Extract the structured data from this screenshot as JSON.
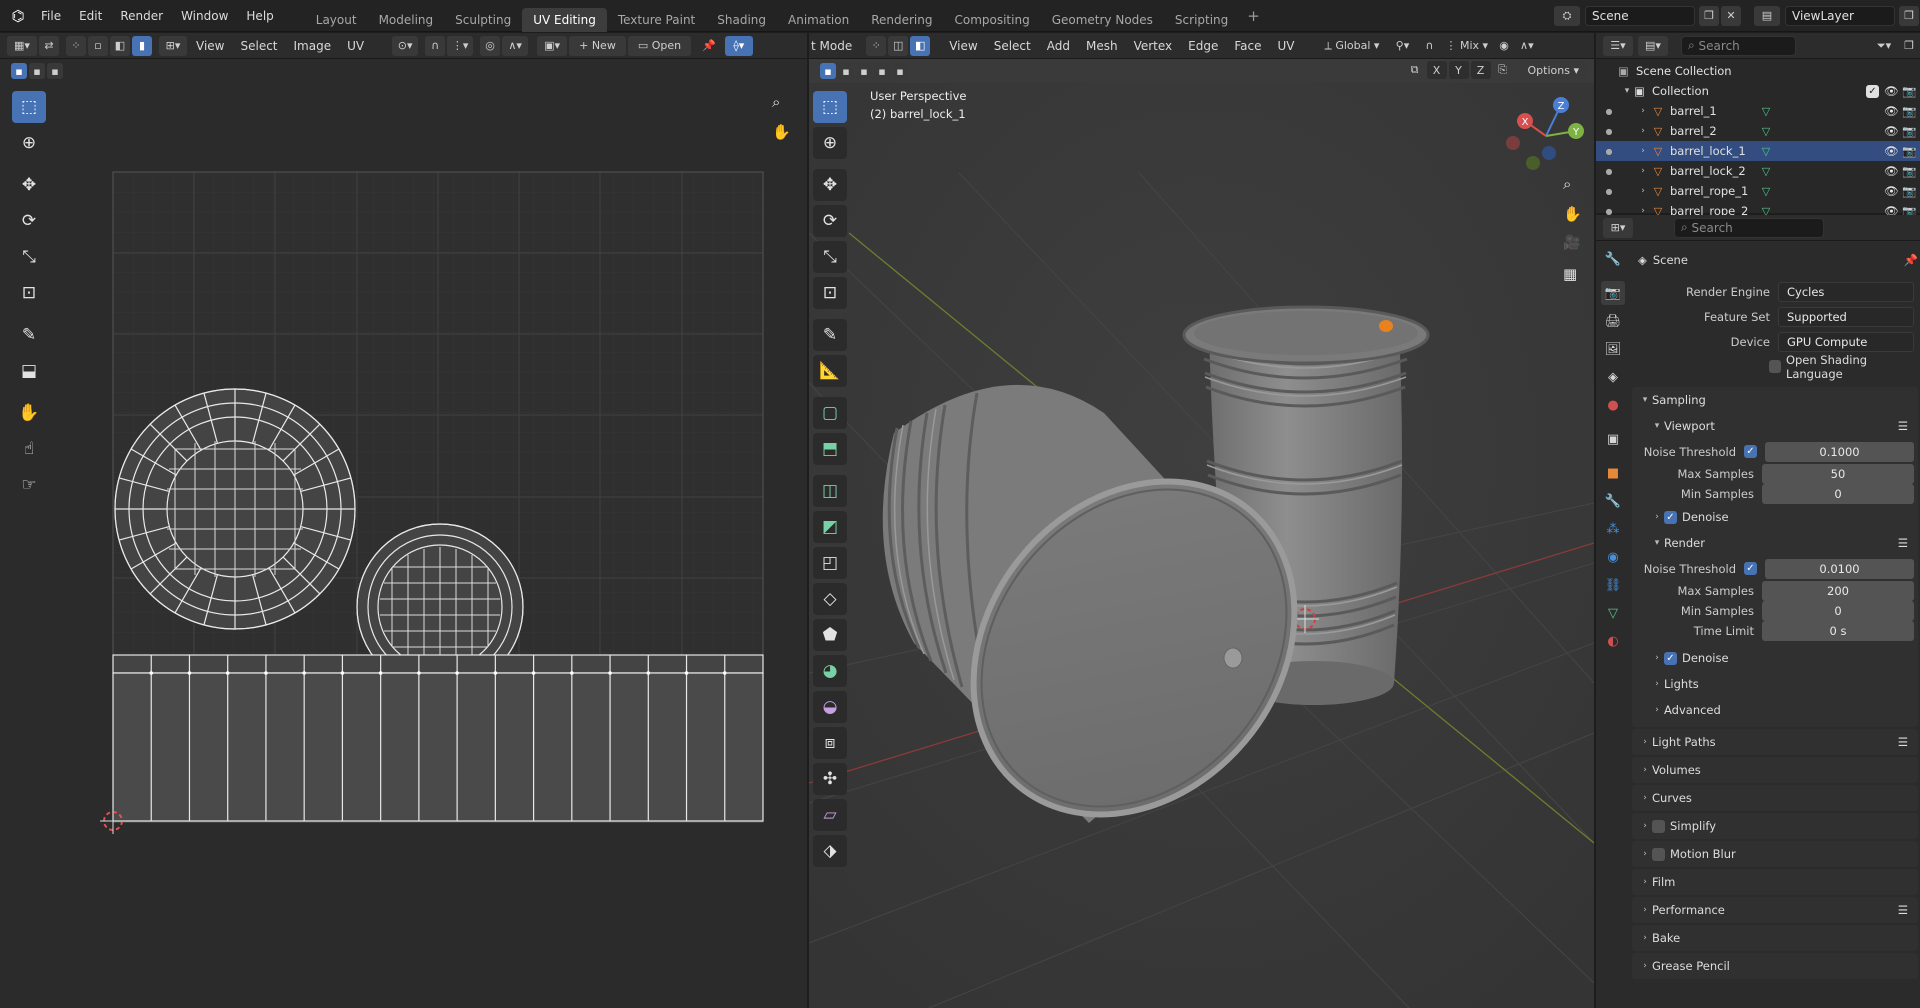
{
  "topbar": {
    "menus": [
      "File",
      "Edit",
      "Render",
      "Window",
      "Help"
    ],
    "workspaces": [
      "Layout",
      "Modeling",
      "Sculpting",
      "UV Editing",
      "Texture Paint",
      "Shading",
      "Animation",
      "Rendering",
      "Compositing",
      "Geometry Nodes",
      "Scripting"
    ],
    "active_workspace": "UV Editing",
    "scene": "Scene",
    "view_layer": "ViewLayer"
  },
  "uv_editor": {
    "header_menus": [
      "View",
      "Select",
      "Image",
      "UV"
    ],
    "new_label": "New",
    "open_label": "Open",
    "tools": [
      "select-box-icon",
      "cursor-icon",
      "move-icon",
      "rotate-icon",
      "scale-icon",
      "transform-icon",
      "annotate-icon",
      "rip-region-icon",
      "grab-icon",
      "relax-icon",
      "pinch-icon"
    ]
  },
  "viewport": {
    "mode_label": "t Mode",
    "header_menus": [
      "View",
      "Select",
      "Add",
      "Mesh",
      "Vertex",
      "Edge",
      "Face",
      "UV"
    ],
    "transform_orientation": "Global",
    "mix_label": "Mix",
    "axes": [
      "X",
      "Y",
      "Z"
    ],
    "options_label": "Options",
    "overlay_line1": "User Perspective",
    "overlay_line2": "(2) barrel_lock_1",
    "gizmo_axes": [
      "X",
      "Y",
      "Z"
    ]
  },
  "outliner": {
    "search_placeholder": "Search",
    "root": "Scene Collection",
    "collection": "Collection",
    "items": [
      {
        "name": "barrel_1",
        "selected": false
      },
      {
        "name": "barrel_2",
        "selected": false
      },
      {
        "name": "barrel_lock_1",
        "selected": true
      },
      {
        "name": "barrel_lock_2",
        "selected": false
      },
      {
        "name": "barrel_rope_1",
        "selected": false
      },
      {
        "name": "barrel_rope_2",
        "selected": false
      }
    ]
  },
  "properties": {
    "search_placeholder": "Search",
    "context": "Scene",
    "render_engine_label": "Render Engine",
    "render_engine": "Cycles",
    "feature_set_label": "Feature Set",
    "feature_set": "Supported",
    "device_label": "Device",
    "device": "GPU Compute",
    "osl_label": "Open Shading Language",
    "sampling": "Sampling",
    "viewport": "Viewport",
    "noise_threshold_label": "Noise Threshold",
    "viewport_noise_threshold": "0.1000",
    "max_samples_label": "Max Samples",
    "viewport_max_samples": "50",
    "min_samples_label": "Min Samples",
    "viewport_min_samples": "0",
    "denoise_label": "Denoise",
    "render": "Render",
    "render_noise_threshold": "0.0100",
    "render_max_samples": "200",
    "render_min_samples": "0",
    "time_limit_label": "Time Limit",
    "time_limit": "0 s",
    "lights": "Lights",
    "advanced": "Advanced",
    "panels": [
      "Light Paths",
      "Volumes",
      "Curves",
      "Simplify",
      "Motion Blur",
      "Film",
      "Performance",
      "Bake",
      "Grease Pencil"
    ]
  },
  "colors": {
    "accent": "#4772b3",
    "selected_row": "#334d80",
    "mesh_icon": "#e8893a",
    "data_icon": "#56c28b"
  }
}
